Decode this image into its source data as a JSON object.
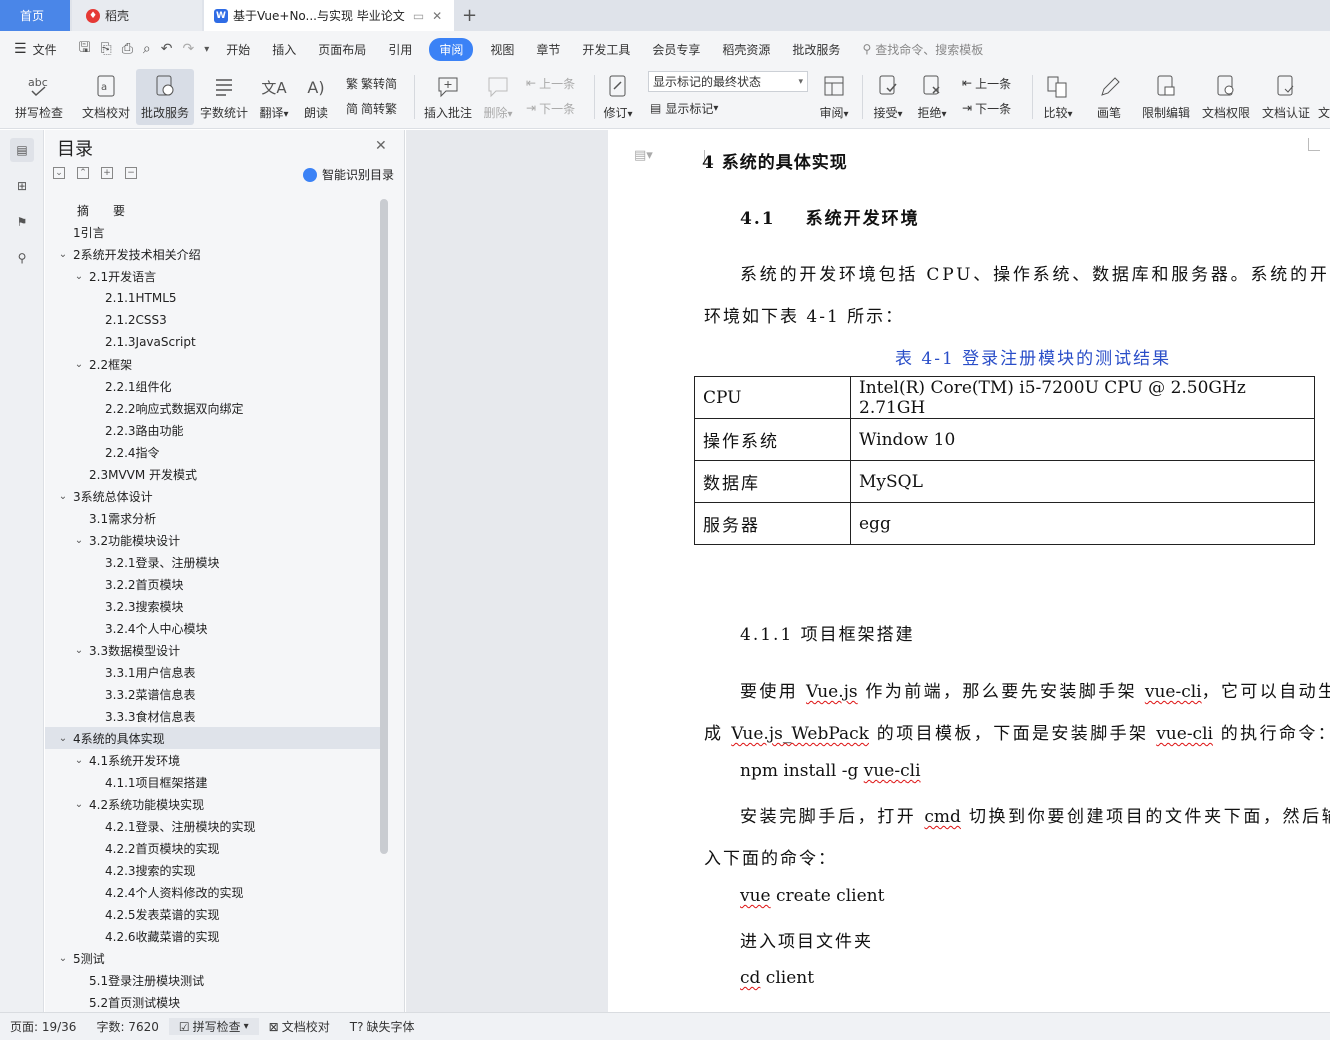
{
  "tabs": {
    "home": "首页",
    "daoke": "稻壳",
    "doc": "基于Vue+No...与实现 毕业论文"
  },
  "menu": {
    "file": "文件",
    "items": [
      "开始",
      "插入",
      "页面布局",
      "引用",
      "审阅",
      "视图",
      "章节",
      "开发工具",
      "会员专享",
      "稻壳资源",
      "批改服务"
    ],
    "active": "审阅",
    "search": "查找命令、搜索模板"
  },
  "ribbon": {
    "spell": "拼写检查",
    "proof": "文档校对",
    "correct": "批改服务",
    "wordcount": "字数统计",
    "translate": "翻译",
    "read": "朗读",
    "t2s": "繁转简",
    "s2t": "简转繁",
    "insert_comment": "插入批注",
    "delete": "删除",
    "prev": "上一条",
    "next": "下一条",
    "track": "修订",
    "markup_state": "显示标记的最终状态",
    "show_markup": "显示标记",
    "review": "审阅",
    "accept": "接受",
    "reject": "拒绝",
    "prev2": "上一条",
    "next2": "下一条",
    "compare": "比较",
    "pen": "画笔",
    "restrict": "限制编辑",
    "permission": "文档权限",
    "certify": "文档认证",
    "more": "文"
  },
  "toc": {
    "title": "目录",
    "smart": "智能识别目录",
    "items": [
      {
        "label": "摘　　要",
        "level": 0,
        "arrow": false
      },
      {
        "label": "1引言",
        "level": 0,
        "arrow": false
      },
      {
        "label": "2系统开发技术相关介绍",
        "level": 0,
        "arrow": true
      },
      {
        "label": "2.1开发语言",
        "level": 1,
        "arrow": true
      },
      {
        "label": "2.1.1HTML5",
        "level": 2,
        "arrow": false
      },
      {
        "label": "2.1.2CSS3",
        "level": 2,
        "arrow": false
      },
      {
        "label": "2.1.3JavaScript",
        "level": 2,
        "arrow": false
      },
      {
        "label": "2.2框架",
        "level": 1,
        "arrow": true
      },
      {
        "label": "2.2.1组件化",
        "level": 2,
        "arrow": false
      },
      {
        "label": "2.2.2响应式数据双向绑定",
        "level": 2,
        "arrow": false
      },
      {
        "label": "2.2.3路由功能",
        "level": 2,
        "arrow": false
      },
      {
        "label": "2.2.4指令",
        "level": 2,
        "arrow": false
      },
      {
        "label": "2.3MVVM 开发模式",
        "level": 1,
        "arrow": false
      },
      {
        "label": "3系统总体设计",
        "level": 0,
        "arrow": true
      },
      {
        "label": "3.1需求分析",
        "level": 1,
        "arrow": false
      },
      {
        "label": "3.2功能模块设计",
        "level": 1,
        "arrow": true
      },
      {
        "label": "3.2.1登录、注册模块",
        "level": 2,
        "arrow": false
      },
      {
        "label": "3.2.2首页模块",
        "level": 2,
        "arrow": false
      },
      {
        "label": "3.2.3搜索模块",
        "level": 2,
        "arrow": false
      },
      {
        "label": "3.2.4个人中心模块",
        "level": 2,
        "arrow": false
      },
      {
        "label": "3.3数据模型设计",
        "level": 1,
        "arrow": true
      },
      {
        "label": "3.3.1用户信息表",
        "level": 2,
        "arrow": false
      },
      {
        "label": "3.3.2菜谱信息表",
        "level": 2,
        "arrow": false
      },
      {
        "label": "3.3.3食材信息表",
        "level": 2,
        "arrow": false
      },
      {
        "label": "4系统的具体实现",
        "level": 0,
        "arrow": true,
        "selected": true
      },
      {
        "label": "4.1系统开发环境",
        "level": 1,
        "arrow": true
      },
      {
        "label": "4.1.1项目框架搭建",
        "level": 2,
        "arrow": false
      },
      {
        "label": "4.2系统功能模块实现",
        "level": 1,
        "arrow": true
      },
      {
        "label": "4.2.1登录、注册模块的实现",
        "level": 2,
        "arrow": false
      },
      {
        "label": "4.2.2首页模块的实现",
        "level": 2,
        "arrow": false
      },
      {
        "label": "4.2.3搜索的实现",
        "level": 2,
        "arrow": false
      },
      {
        "label": "4.2.4个人资料修改的实现",
        "level": 2,
        "arrow": false
      },
      {
        "label": "4.2.5发表菜谱的实现",
        "level": 2,
        "arrow": false
      },
      {
        "label": "4.2.6收藏菜谱的实现",
        "level": 2,
        "arrow": false
      },
      {
        "label": "5测试",
        "level": 0,
        "arrow": true
      },
      {
        "label": "5.1登录注册模块测试",
        "level": 1,
        "arrow": false
      },
      {
        "label": "5.2首页测试模块",
        "level": 1,
        "arrow": false
      }
    ]
  },
  "doc": {
    "h1": "4 系统的具体实现",
    "h2_num": "4.1",
    "h2_text": "系统开发环境",
    "para1_a": "系统的开发环境包括 CPU、操作系统、数据库和服务器。系统的开发",
    "para1_b": "环境如下表 4-1 所示：",
    "caption": "表 4-1 登录注册模块的测试结果",
    "table": [
      [
        "CPU",
        "Intel(R) Core(TM) i5-7200U CPU @ 2.50GHz 2.71GH"
      ],
      [
        "操作系统",
        "Window 10"
      ],
      [
        "数据库",
        "MySQL"
      ],
      [
        "服务器",
        "egg"
      ]
    ],
    "h3": "4.1.1  项目框架搭建",
    "para2_a": "要使用 ",
    "para2_vue": "Vue.js",
    "para2_b": " 作为前端，那么要先安装脚手架 ",
    "para2_cli": "vue-cli",
    "para2_c": "，它可以自动生",
    "para3_a": "成 ",
    "para3_pack": "Vue.js_WebPack",
    "para3_b": " 的项目模板，下面是安装脚手架 ",
    "para3_cli": "vue-cli",
    "para3_c": " 的执行命令：",
    "cmd1_a": "npm install -g ",
    "cmd1_b": "vue-cli",
    "para4_a": "安装完脚手后，打开 ",
    "para4_cmd": "cmd",
    "para4_b": " 切换到你要创建项目的文件夹下面，然后输",
    "para5": "入下面的命令：",
    "cmd2_a": "vue",
    "cmd2_b": " create client",
    "para6": "进入项目文件夹",
    "cmd3_a": "cd",
    "cmd3_b": " client"
  },
  "status": {
    "page": "页面: 19/36",
    "words": "字数: 7620",
    "spell": "拼写检查",
    "proof": "文档校对",
    "font": "缺失字体"
  }
}
